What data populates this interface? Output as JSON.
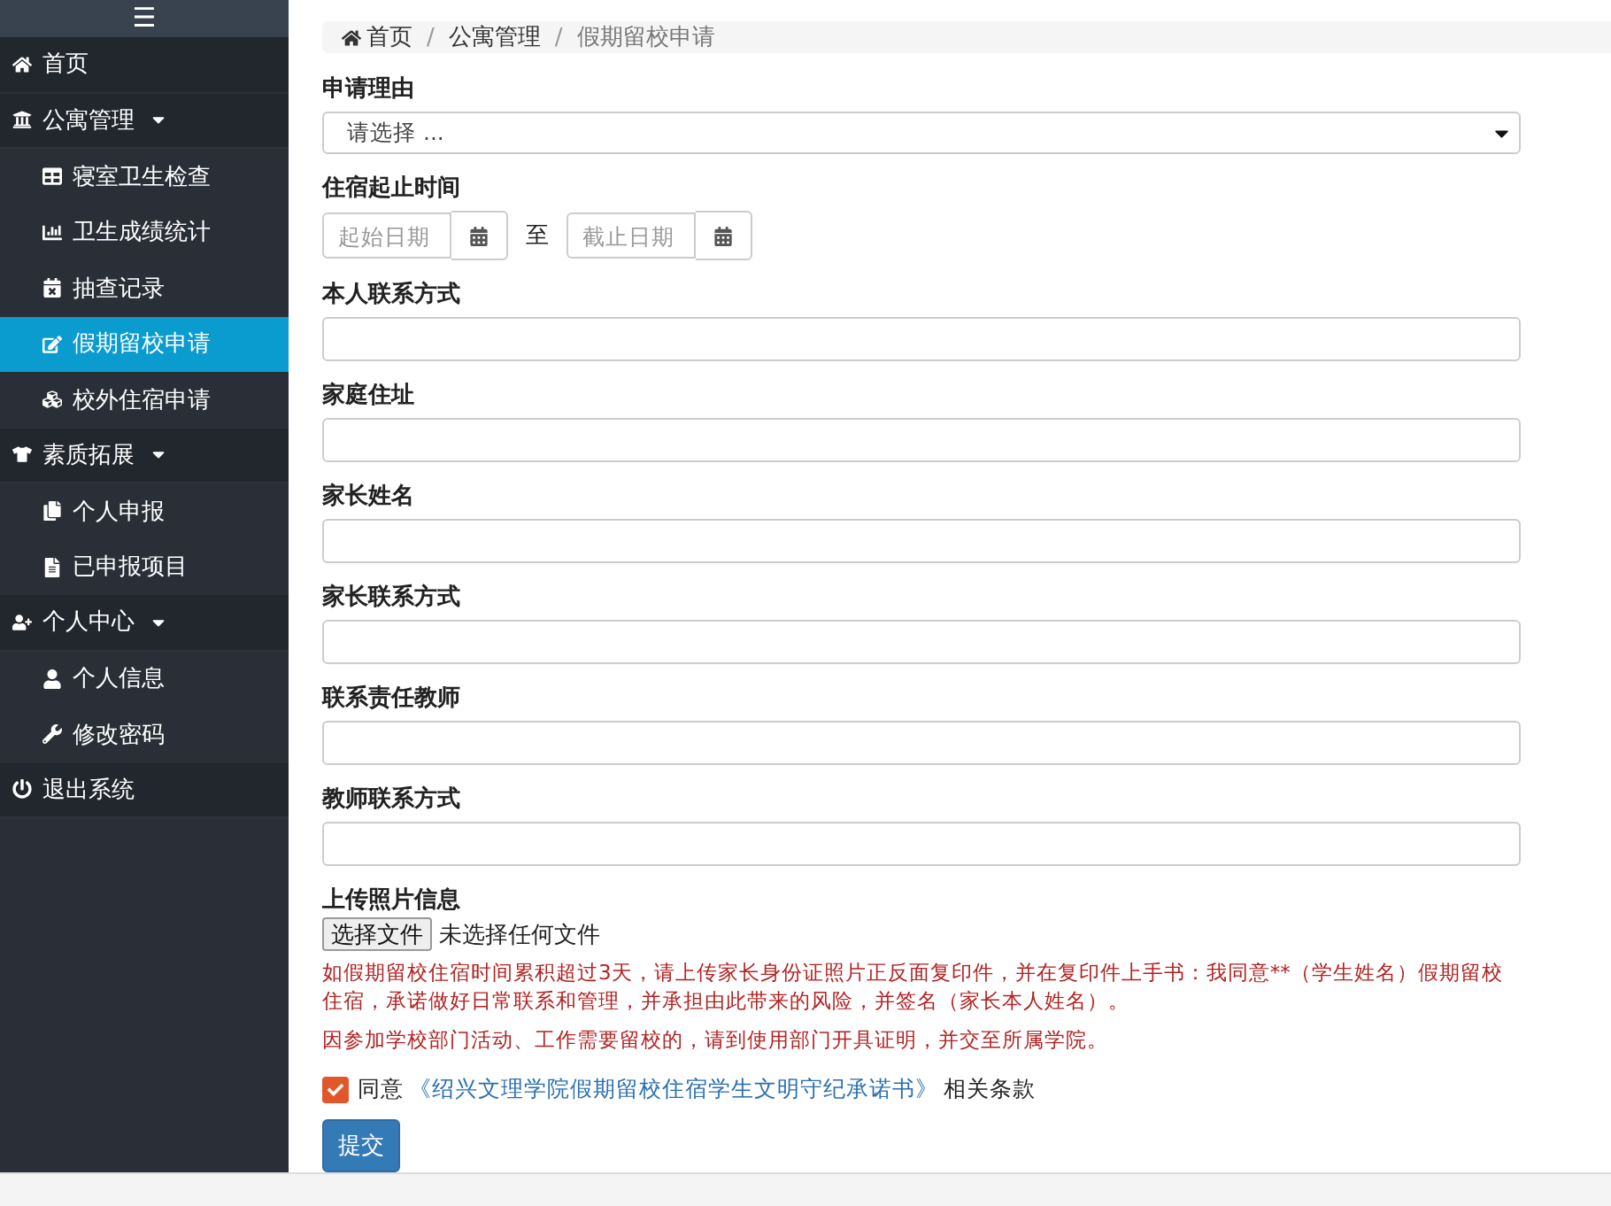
{
  "sidebar": {
    "menu_toggle": "☰",
    "items": [
      {
        "kind": "item",
        "label": "首页",
        "selected": false
      },
      {
        "kind": "group",
        "label": "公寓管理",
        "expanded": true,
        "children": [
          {
            "label": "寝室卫生检查",
            "selected": false
          },
          {
            "label": "卫生成绩统计",
            "selected": false
          },
          {
            "label": "抽查记录",
            "selected": false
          },
          {
            "label": "假期留校申请",
            "selected": true
          },
          {
            "label": "校外住宿申请",
            "selected": false
          }
        ]
      },
      {
        "kind": "group",
        "label": "素质拓展",
        "expanded": true,
        "children": [
          {
            "label": "个人申报",
            "selected": false
          },
          {
            "label": "已申报项目",
            "selected": false
          }
        ]
      },
      {
        "kind": "group",
        "label": "个人中心",
        "expanded": true,
        "children": [
          {
            "label": "个人信息",
            "selected": false
          },
          {
            "label": "修改密码",
            "selected": false
          }
        ]
      },
      {
        "kind": "item",
        "label": "退出系统",
        "selected": false
      }
    ]
  },
  "breadcrumb": {
    "separator": "/",
    "items": [
      "首页",
      "公寓管理",
      "假期留校申请"
    ]
  },
  "form": {
    "fields": [
      {
        "kind": "select",
        "label": "申请理由",
        "value": "请选择 ..."
      },
      {
        "kind": "daterange",
        "label": "住宿起止时间",
        "start_placeholder": "起始日期",
        "separator": "至",
        "end_placeholder": "截止日期"
      },
      {
        "kind": "text",
        "label": "本人联系方式"
      },
      {
        "kind": "text",
        "label": "家庭住址"
      },
      {
        "kind": "text",
        "label": "家长姓名"
      },
      {
        "kind": "text",
        "label": "家长联系方式"
      },
      {
        "kind": "text",
        "label": "联系责任教师"
      },
      {
        "kind": "text",
        "label": "教师联系方式"
      },
      {
        "kind": "file",
        "label": "上传照片信息",
        "button": "选择文件",
        "status": "未选择任何文件"
      }
    ],
    "notes": [
      "如假期留校住宿时间累积超过3天，请上传家长身份证照片正反面复印件，并在复印件上手书：我同意**（学生姓名）假期留校住宿，承诺做好日常联系和管理，并承担由此带来的风险，并签名（家长本人姓名）。",
      "因参加学校部门活动、工作需要留校的，请到使用部门开具证明，并交至所属学院。"
    ],
    "agreement": {
      "checked": true,
      "prefix": "同意",
      "link": "《绍兴文理学院假期留校住宿学生文明守纪承诺书》",
      "suffix": "相关条款"
    },
    "submit": "提交"
  }
}
